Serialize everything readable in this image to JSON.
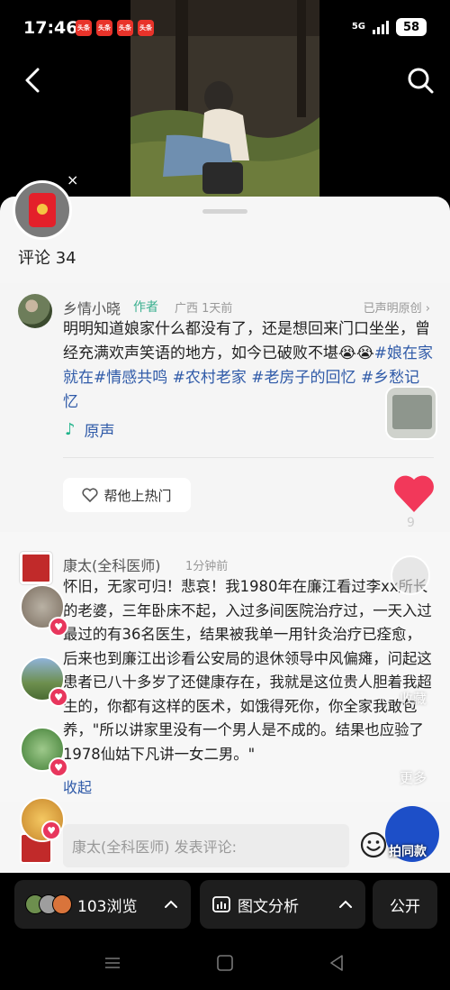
{
  "status_bar": {
    "time": "17:46",
    "app_icons": [
      "头条",
      "头条",
      "头条",
      "头条"
    ],
    "network": "5G",
    "battery": "58"
  },
  "red_packet": {
    "close_symbol": "×"
  },
  "sheet": {
    "comment_count": "评论 34"
  },
  "author_post": {
    "name": "乡情小晓",
    "tag": "作者",
    "meta": "广西 1天前",
    "original_label": "已声明原创 ›",
    "text": "明明知道娘家什么都没有了，还是想回来门口坐坐，曾经充满欢声笑语的地方，如今已破败不堪",
    "emoji": "😭😭",
    "hashtags": "#娘在家就在#情感共鸣 #农村老家 #老房子的回忆 #乡愁记忆",
    "sound_label": "原声",
    "hot_button": "帮他上热门",
    "likes": "9"
  },
  "comment": {
    "name": "康太(全科医师)",
    "time": "1分钟前",
    "text": "怀旧，无家可归！悲哀！我1980年在廉江看过李xx所长的老婆，三年卧床不起，入过多间医院治疗过，一天入过最过的有36名医生，结果被我单一用针灸治疗已痊愈，后来也到廉江出诊看公安局的退休领导中风偏瘫，问起这患者已八十多岁了还健康存在，我就是这位贵人胆着我超生的，你都有这样的医术，如饿得死你，你全家我敢包养，\"所以讲家里没有一个男人是不成的。结果也应验了1978仙姑下凡讲一女二男。\"",
    "collapse": "收起"
  },
  "side_labels": {
    "collect": "收藏",
    "more": "更多"
  },
  "input_bar": {
    "placeholder": "康太(全科医师) 发表评论:",
    "same_style": "拍同款"
  },
  "toolbar": {
    "views": "103浏览",
    "analysis": "图文分析",
    "public": "公开"
  },
  "colors": {
    "accent_blue": "#2f5aa8",
    "author_tag_green": "#3bb08f",
    "like_red": "#f2385a"
  }
}
